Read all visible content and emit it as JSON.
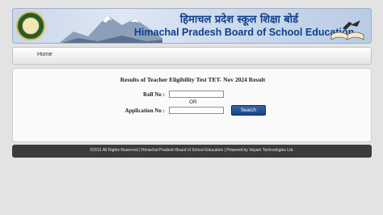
{
  "header": {
    "title_hindi": "हिमाचल प्रदेश स्कूल शिक्षा बोर्ड",
    "title_english": "Himachal Pradesh Board of School Education"
  },
  "nav": {
    "home_label": "Home"
  },
  "form": {
    "heading": "Results of Teacher Eligibility Test TET- Nov 2024 Result",
    "roll_label": "Roll No :",
    "roll_value": "",
    "or_text": "OR",
    "application_label": "Application No :",
    "application_value": "",
    "search_label": "Search"
  },
  "footer": {
    "text": "©2011 All Rights Reserved | Himachal Pradesh Board of School Education | Powered by Vayam Technologies Ltd."
  },
  "colors": {
    "brand_blue": "#0e3f8c",
    "button_blue": "#1f4f8f",
    "footer_bg": "#3b3b3b"
  },
  "icons": {
    "logo": "board-seal-icon",
    "banner_art": "open-book-icon"
  }
}
